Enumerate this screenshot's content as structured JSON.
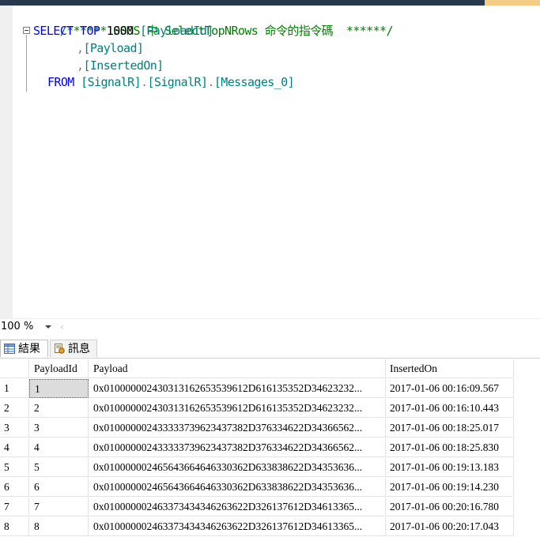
{
  "editor": {
    "comment": "/****** SSMS 中 SelectTopNRows 命令的指令碼  ******/",
    "select_kw": "SELECT",
    "top_kw": "TOP",
    "top_n": "1000",
    "col1": "[PayloadId]",
    "col2": "[Payload]",
    "col3": "[InsertedOn]",
    "comma": ",",
    "from_kw": "FROM",
    "table_schema": "[SignalR]",
    "table_dot1": ".",
    "table_db": "[SignalR]",
    "table_dot2": ".",
    "table_name": "[Messages_0]"
  },
  "zoom": {
    "value": "100 %"
  },
  "tabs": {
    "results": "結果",
    "messages": "訊息"
  },
  "grid": {
    "headers": [
      "PayloadId",
      "Payload",
      "InsertedOn"
    ],
    "rows": [
      {
        "n": "1",
        "id": "1",
        "payload": "0x0100000024303131626535396 12D616135352D34623232...",
        "inserted": "2017-01-06 00:16:09.567"
      },
      {
        "n": "2",
        "id": "2",
        "payload": "0x010000002430313162653539612D616135352D34623232...",
        "inserted": "2017-01-06 00:16:10.443"
      },
      {
        "n": "3",
        "id": "3",
        "payload": "0x0100000024333337396 23437382D376334622D34366562...",
        "inserted": "2017-01-06 00:18:25.017"
      },
      {
        "n": "4",
        "id": "4",
        "payload": "0x01000000243333373962343738 2D376334622D34366562...",
        "inserted": "2017-01-06 00:18:25.830"
      },
      {
        "n": "5",
        "id": "5",
        "payload": "0x01000000246564366 4646330362D633838622D34353636...",
        "inserted": "2017-01-06 00:19:13.183"
      },
      {
        "n": "6",
        "id": "6",
        "payload": "0x0100000024656436646 46330362D633838622D34353636...",
        "inserted": "2017-01-06 00:19:14.230"
      },
      {
        "n": "7",
        "id": "7",
        "payload": "0x01000000246337343434626 3622D326137612D34613365...",
        "inserted": "2017-01-06 00:20:16.780"
      },
      {
        "n": "8",
        "id": "8",
        "payload": "0x0100000024633734343462636 22D326137612D34613365...",
        "inserted": "2017-01-06 00:20:17.043"
      }
    ]
  }
}
